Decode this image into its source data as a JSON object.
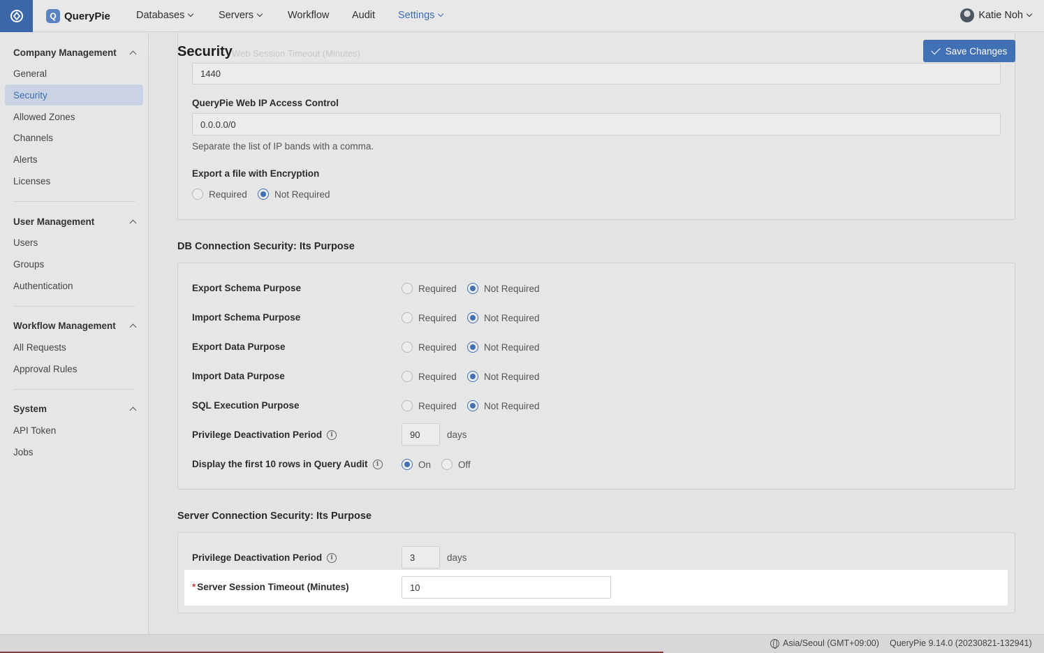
{
  "app": {
    "brand": "QueryPie"
  },
  "nav": {
    "databases": "Databases",
    "servers": "Servers",
    "workflow": "Workflow",
    "audit": "Audit",
    "settings": "Settings",
    "user": "Katie Noh"
  },
  "sidebar": {
    "company": {
      "title": "Company Management",
      "items": [
        "General",
        "Security",
        "Allowed Zones",
        "Channels",
        "Alerts",
        "Licenses"
      ]
    },
    "user": {
      "title": "User Management",
      "items": [
        "Users",
        "Groups",
        "Authentication"
      ]
    },
    "workflow": {
      "title": "Workflow Management",
      "items": [
        "All Requests",
        "Approval Rules"
      ]
    },
    "system": {
      "title": "System",
      "items": [
        "API Token",
        "Jobs"
      ]
    },
    "active": "Security"
  },
  "page": {
    "title": "Security",
    "ghost_label": "Web Session Timeout (Minutes)",
    "save_label": "Save Changes"
  },
  "general": {
    "session_timeout_value": "1440",
    "ip_label": "QueryPie Web IP Access Control",
    "ip_value": "0.0.0.0/0",
    "ip_help": "Separate the list of IP bands with a comma.",
    "export_label": "Export a file with Encryption",
    "export_options": [
      "Required",
      "Not Required"
    ],
    "export_selected": "Not Required"
  },
  "db": {
    "title": "DB Connection Security: Its Purpose",
    "rows": [
      {
        "label": "Export Schema Purpose",
        "selected": "Not Required"
      },
      {
        "label": "Import Schema Purpose",
        "selected": "Not Required"
      },
      {
        "label": "Export Data Purpose",
        "selected": "Not Required"
      },
      {
        "label": "Import Data Purpose",
        "selected": "Not Required"
      },
      {
        "label": "SQL Execution Purpose",
        "selected": "Not Required"
      }
    ],
    "option_required": "Required",
    "option_not_required": "Not Required",
    "privilege_label": "Privilege Deactivation Period",
    "privilege_value": "90",
    "privilege_unit": "days",
    "display_label": "Display the first 10 rows in Query Audit",
    "display_on": "On",
    "display_off": "Off",
    "display_selected": "On"
  },
  "server": {
    "title": "Server Connection Security: Its Purpose",
    "privilege_label": "Privilege Deactivation Period",
    "privilege_value": "3",
    "privilege_unit": "days",
    "timeout_label": "Server Session Timeout (Minutes)",
    "timeout_value": "10"
  },
  "footer": {
    "timezone": "Asia/Seoul (GMT+09:00)",
    "version": "QueryPie 9.14.0 (20230821-132941)"
  },
  "colors": {
    "accent": "#4170b5",
    "home": "#3b67a8",
    "active_bg": "#c9d3e3",
    "required": "#d23b3b"
  }
}
